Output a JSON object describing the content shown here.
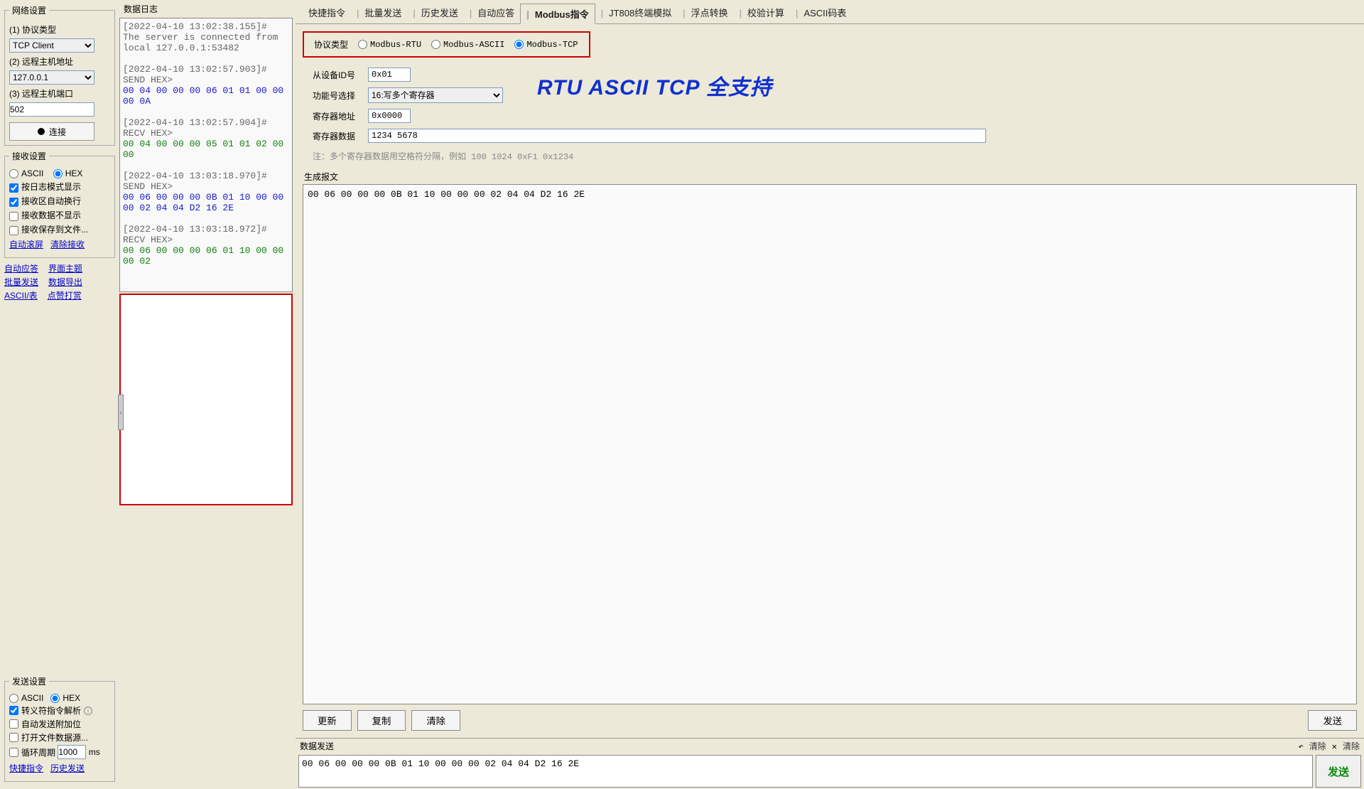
{
  "left": {
    "network_title": "网络设置",
    "protocol_label": "(1) 协议类型",
    "protocol_value": "TCP Client",
    "host_label": "(2) 远程主机地址",
    "host_value": "127.0.0.1",
    "port_label": "(3) 远程主机端口",
    "port_value": "502",
    "connect_label": "连接",
    "recv_title": "接收设置",
    "ascii": "ASCII",
    "hex": "HEX",
    "chk_logmode": "按日志模式显示",
    "chk_wrap": "接收区自动换行",
    "chk_hidesend": "接收数据不显示",
    "chk_savefile": "接收保存到文件...",
    "link_autoscroll": "自动滚屏",
    "link_clearrecv": "清除接收",
    "link_autoresp": "自动应答",
    "link_theme": "界面主题",
    "link_batchsend": "批量发送",
    "link_export": "数据导出",
    "link_asciitable": "ASCII/表",
    "link_donate": "点赞打赏",
    "send_title": "发送设置",
    "chk_escape": "转义符指令解析",
    "chk_appendbit": "自动发送附加位",
    "chk_openfile": "打开文件数据源...",
    "chk_cycle": "循环周期",
    "cycle_value": "1000",
    "cycle_unit": "ms",
    "link_shortcut": "快捷指令",
    "link_history": "历史发送"
  },
  "log": {
    "title": "数据日志",
    "entries": [
      {
        "ts": "[2022-04-10 13:02:38.155]# ",
        "text": "The server is connected from local 127.0.0.1:53482",
        "cls": "ts"
      },
      {
        "ts": "[2022-04-10 13:02:57.903]# SEND HEX>",
        "text": "00 04 00 00 00 06 01 01 00 00 00 0A",
        "cls": "send"
      },
      {
        "ts": "[2022-04-10 13:02:57.904]# RECV HEX>",
        "text": "00 04 00 00 00 05 01 01 02 00 00",
        "cls": "recv"
      },
      {
        "ts": "[2022-04-10 13:03:18.970]# SEND HEX>",
        "text": "00 06 00 00 00 0B 01 10 00 00 00 02 04 04 D2 16 2E",
        "cls": "send"
      },
      {
        "ts": "[2022-04-10 13:03:18.972]# RECV HEX>",
        "text": "00 06 00 00 00 06 01 10 00 00 00 02",
        "cls": "recv"
      }
    ]
  },
  "tabs": [
    "快捷指令",
    "批量发送",
    "历史发送",
    "自动应答",
    "Modbus指令",
    "JT808终端模拟",
    "浮点转换",
    "校验计算",
    "ASCII码表"
  ],
  "active_tab": "Modbus指令",
  "modbus": {
    "proto_label": "协议类型",
    "opt_rtu": "Modbus-RTU",
    "opt_ascii": "Modbus-ASCII",
    "opt_tcp": "Modbus-TCP",
    "slave_label": "从设备ID号",
    "slave_value": "0x01",
    "func_label": "功能号选择",
    "func_value": "16:写多个寄存器",
    "addr_label": "寄存器地址",
    "addr_value": "0x0000",
    "data_label": "寄存器数据",
    "data_value": "1234 5678",
    "note": "注：多个寄存器数据用空格符分隔，例如 100 1024 0xF1 0x1234",
    "banner": "RTU ASCII TCP 全支持",
    "gen_label": "生成报文",
    "gen_output": "00 06 00 00 00 0B 01 10 00 00 00 02 04 04 D2 16 2E",
    "btn_update": "更新",
    "btn_copy": "复制",
    "btn_clear": "清除",
    "btn_send_bottom": "发送"
  },
  "bottom": {
    "title": "数据发送",
    "clear1": "清除",
    "clear2": "清除",
    "text": "00 06 00 00 00 0B 01 10 00 00 00 02 04 04 D2 16 2E",
    "send": "发送"
  }
}
